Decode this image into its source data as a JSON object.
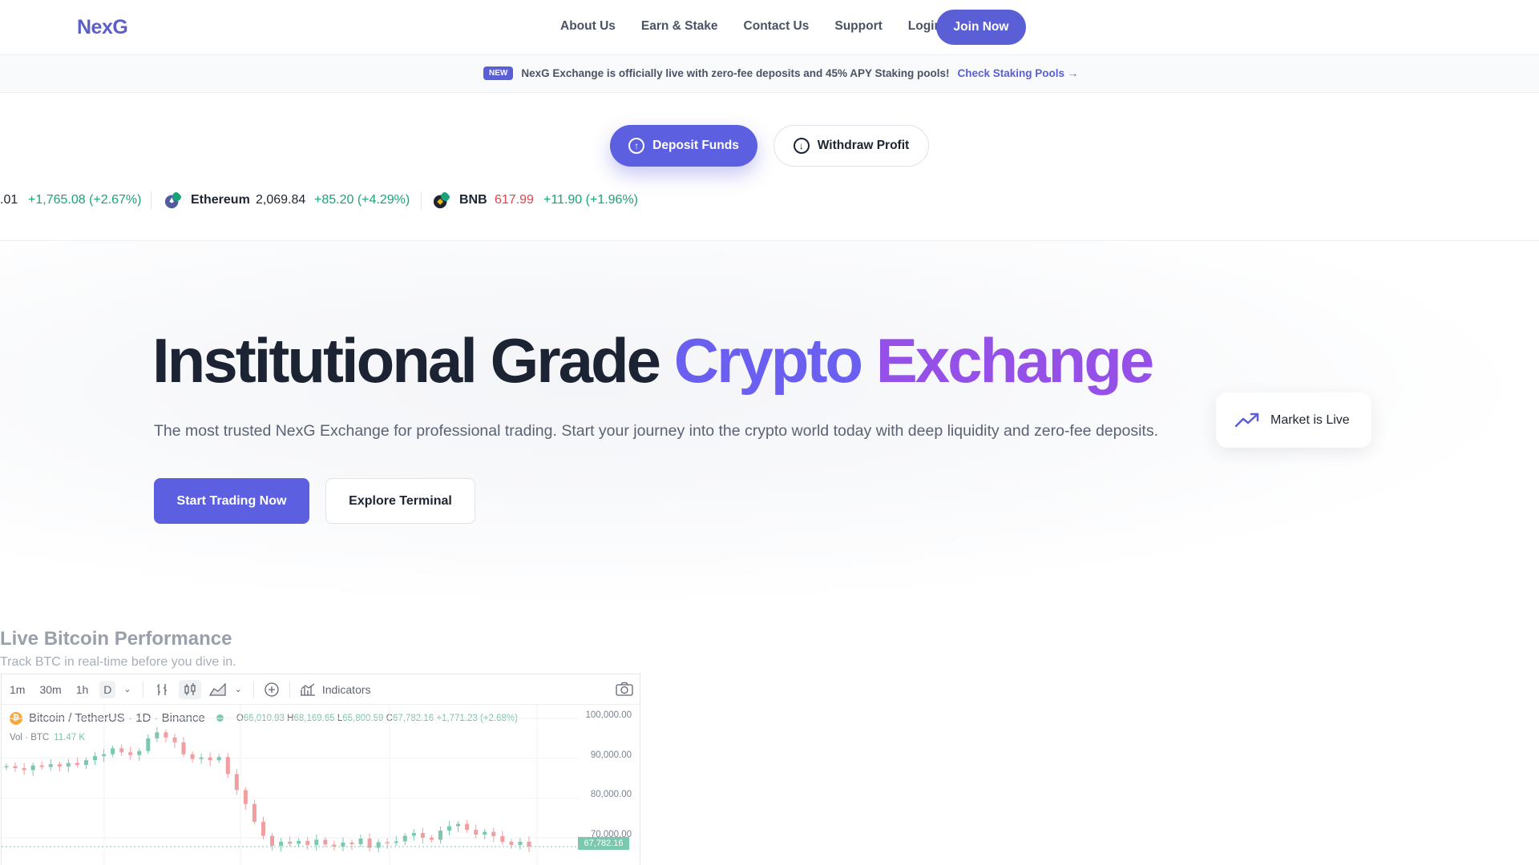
{
  "header": {
    "logo": "NexG",
    "nav": [
      "About Us",
      "Earn & Stake",
      "Contact Us",
      "Support",
      "Login"
    ],
    "join_label": "Join Now"
  },
  "announcement": {
    "badge": "NEW",
    "text": "NexG Exchange is officially live with zero-fee deposits and 45% APY Staking pools!",
    "link": "Check Staking Pools →"
  },
  "actions": {
    "deposit_label": "Deposit Funds",
    "withdraw_label": "Withdraw Profit"
  },
  "ticker": {
    "first_price_partial": ".01",
    "first_change": "+1,765.08 (+2.67%)",
    "items": [
      {
        "name": "Ethereum",
        "price": "2,069.84",
        "change": "+85.20 (+4.29%)",
        "icon": "ethereum-icon",
        "price_color": "#1e2532"
      },
      {
        "name": "BNB",
        "price": "617.99",
        "change": "+11.90 (+1.96%)",
        "icon": "bnb-icon",
        "price_color": "#e0454a"
      }
    ]
  },
  "hero": {
    "title_dark": "Institutional Grade",
    "title_accent1": "Crypto",
    "title_accent2": "Exchange",
    "subtitle": "The most trusted NexG Exchange for professional trading. Start your journey into the crypto world today with deep liquidity and zero-fee deposits.",
    "primary_cta": "Start Trading Now",
    "secondary_cta": "Explore Terminal",
    "live_badge": "Market is Live"
  },
  "chart_section": {
    "title": "Live Bitcoin Performance",
    "subtitle": "Track BTC in real-time before you dive in.",
    "toolbar": {
      "intervals": [
        "1m",
        "30m",
        "1h",
        "D"
      ],
      "indicators_label": "Indicators"
    },
    "legend": {
      "symbol": "Bitcoin / TetherUS · 1D · Binance",
      "o_label": "O",
      "o": "66,010.93",
      "h_label": "H",
      "h": "68,169.65",
      "l_label": "L",
      "l": "65,800.59",
      "c_label": "C",
      "c": "67,782.16",
      "change": "+1,771.23 (+2.68%)",
      "vol_label": "Vol · BTC",
      "vol_value": "11.47 K"
    },
    "last_price_tag": "67,782.16"
  },
  "chart_data": {
    "type": "candlestick",
    "title": "Bitcoin / TetherUS · 1D · Binance",
    "y_ticks": [
      "100,000.00",
      "90,000.00",
      "80,000.00",
      "70,000.00"
    ],
    "ylim": [
      63000,
      101000
    ],
    "series": [
      {
        "values": [
          88000,
          87500,
          87000,
          88200,
          87800,
          88500,
          87900,
          88800,
          88300,
          89500,
          90500,
          91000,
          92500,
          91500,
          90800,
          91800,
          95000,
          96500,
          95200,
          94000,
          91000,
          89800,
          90200,
          89500,
          90300,
          86000,
          82000,
          78500,
          74000,
          70500,
          68000,
          69000,
          68500,
          69200,
          68200,
          69500,
          68300,
          67800,
          68800,
          68400,
          69800,
          67500,
          68900,
          68700,
          69100,
          70500,
          71200,
          70000,
          69500,
          71800,
          72900,
          73500,
          72000,
          70800,
          71500,
          70400,
          69000,
          68200,
          69000,
          67782
        ]
      }
    ]
  }
}
